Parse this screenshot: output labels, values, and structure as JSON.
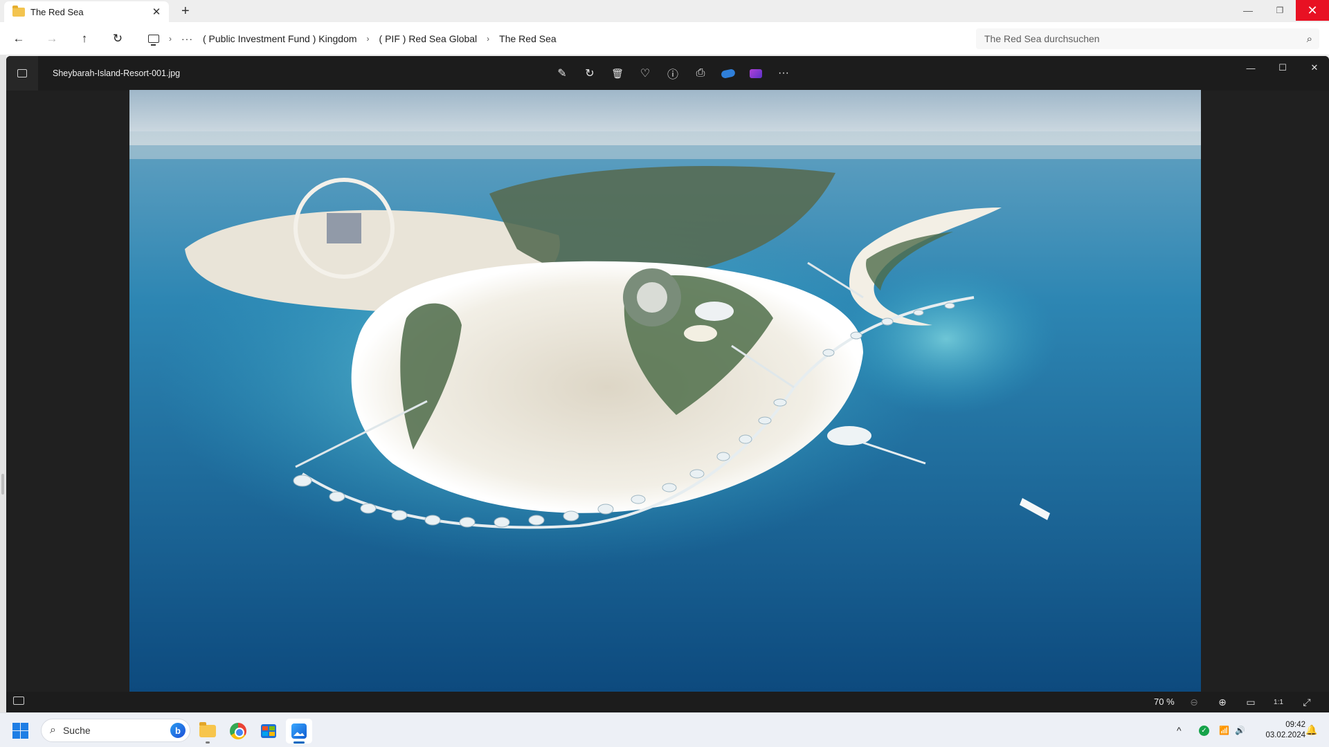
{
  "explorer": {
    "tab_title": "The Red Sea",
    "tab_close": "✕",
    "new_tab": "+",
    "window_controls": {
      "minimize": "—",
      "restore": "❐",
      "close": "✕"
    },
    "nav": {
      "back": "←",
      "forward": "→",
      "up": "↑",
      "refresh": "↻"
    },
    "breadcrumb": {
      "chevron": "›",
      "overflow": "···",
      "items": [
        "( Public Investment Fund ) Kingdom",
        "( PIF ) Red Sea Global",
        "The Red Sea"
      ]
    },
    "search_placeholder": "The Red Sea durchsuchen",
    "search_icon": "⌕"
  },
  "photos": {
    "filename": "Sheybarah-Island-Resort-001.jpg",
    "toolbar": {
      "edit": "✎",
      "rotate": "↻",
      "delete": "🗑",
      "favorite": "♡",
      "info": "ⓘ",
      "print": "⎙",
      "more": "···",
      "icons": [
        "edit-icon",
        "rotate-icon",
        "delete-icon",
        "heart-icon",
        "info-icon",
        "print-icon",
        "onedrive-icon",
        "clipchamp-icon",
        "more-icon"
      ]
    },
    "window_controls": {
      "minimize": "—",
      "maximize": "☐",
      "close": "✕"
    },
    "zoom_level": "70 %",
    "bottom_icons": {
      "zoom_out": "⊖",
      "zoom_in": "⊕",
      "fit": "▭",
      "actual_size": "1:1",
      "fullscreen": "⤢"
    }
  },
  "taskbar": {
    "search_label": "Suche",
    "search_icon": "⌕",
    "bing_label": "b",
    "apps": [
      "file-explorer",
      "chrome",
      "microsoft-store",
      "photos"
    ],
    "tray": {
      "chevron": "^",
      "wifi": "📶",
      "volume": "🔊"
    },
    "time": "09:42",
    "date": "03.02.2024",
    "bell": "🔔"
  },
  "colors": {
    "accent": "#0067c0",
    "close_red": "#e81123",
    "photos_bg": "#202020",
    "sea_deep": "#0f4f86",
    "sand": "#efe9dc"
  }
}
